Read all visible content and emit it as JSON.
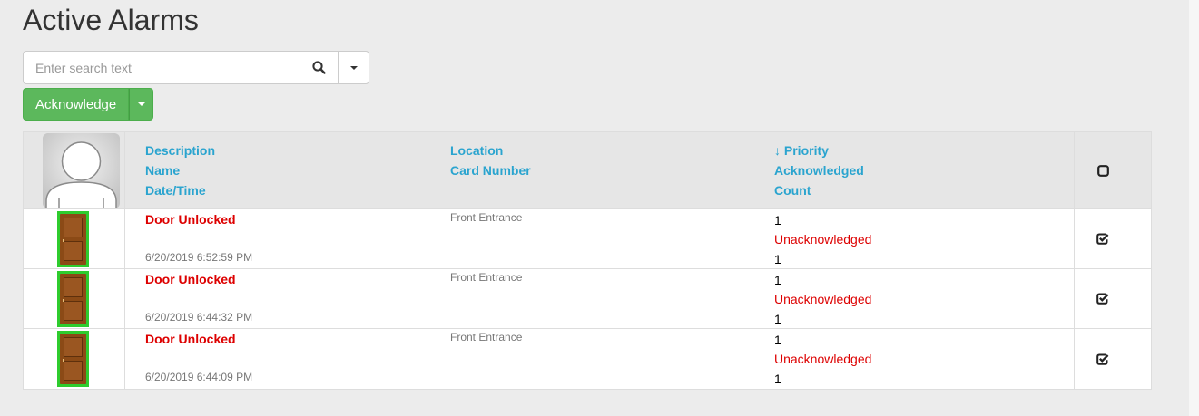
{
  "page": {
    "title": "Active Alarms"
  },
  "search": {
    "placeholder": "Enter search text",
    "value": ""
  },
  "toolbar": {
    "acknowledge_label": "Acknowledge"
  },
  "columns": {
    "col1": [
      "Description",
      "Name",
      "Date/Time"
    ],
    "col2": [
      "Location",
      "Card Number"
    ],
    "col3_sort_indicator": "↓",
    "col3": [
      "Priority",
      "Acknowledged",
      "Count"
    ]
  },
  "colors": {
    "accent": "#2aa4cf",
    "success": "#5cb85c",
    "alert": "#dd0000"
  },
  "rows": [
    {
      "description": "Door Unlocked",
      "name": "",
      "datetime": "6/20/2019 6:52:59 PM",
      "location": "Front Entrance",
      "card_number": "",
      "priority": "1",
      "acknowledged": "Unacknowledged",
      "count": "1",
      "icon": "door-icon"
    },
    {
      "description": "Door Unlocked",
      "name": "",
      "datetime": "6/20/2019 6:44:32 PM",
      "location": "Front Entrance",
      "card_number": "",
      "priority": "1",
      "acknowledged": "Unacknowledged",
      "count": "1",
      "icon": "door-icon"
    },
    {
      "description": "Door Unlocked",
      "name": "",
      "datetime": "6/20/2019 6:44:09 PM",
      "location": "Front Entrance",
      "card_number": "",
      "priority": "1",
      "acknowledged": "Unacknowledged",
      "count": "1",
      "icon": "door-icon"
    }
  ]
}
